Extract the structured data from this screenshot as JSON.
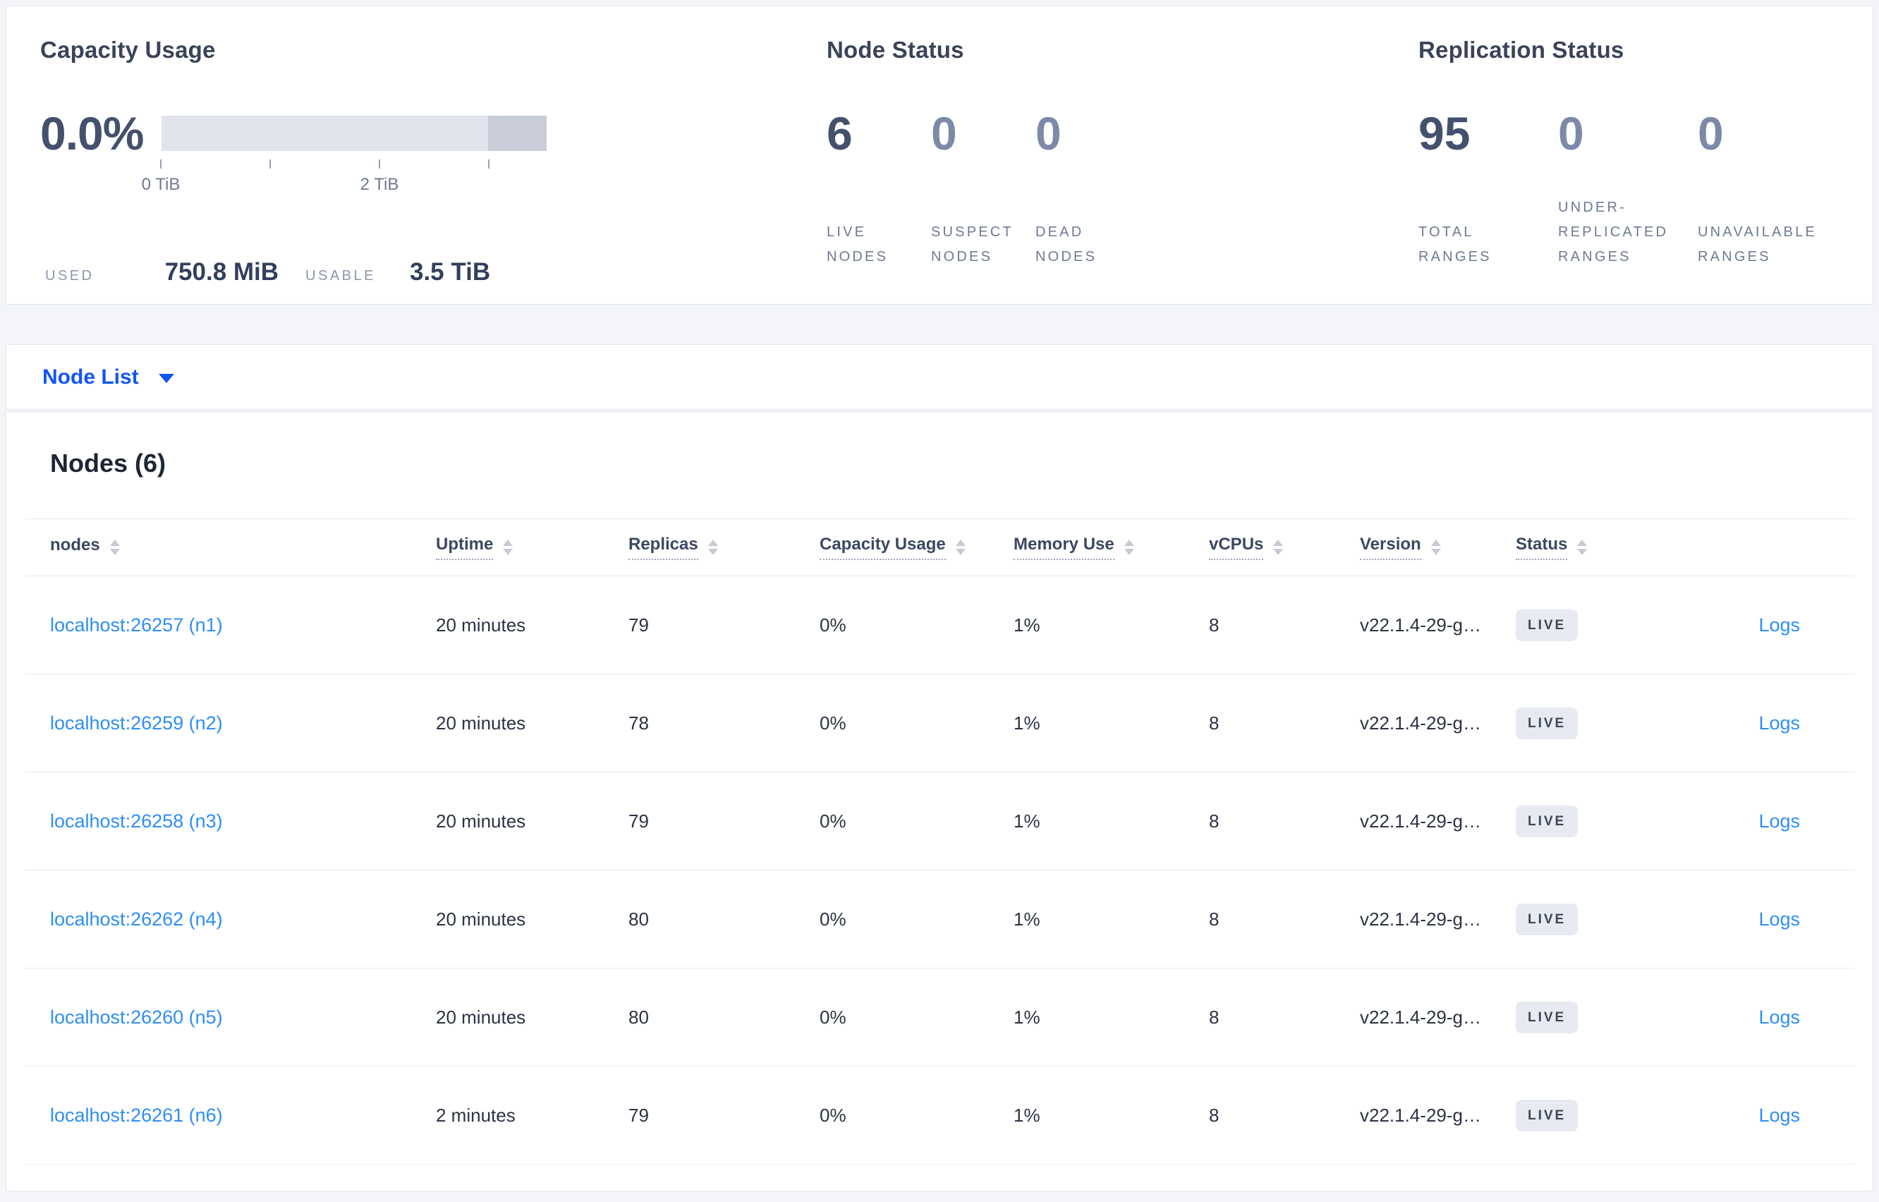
{
  "colors": {
    "primary_blue": "#1355f2",
    "link_blue": "#2f8ef3",
    "emphasis_number": "#44516d",
    "muted_number": "#7c89a8",
    "gauge_light": "#e2e4ed",
    "gauge_dark": "#c8cdd9",
    "live_badge_bg": "#e7eaf1"
  },
  "summary": {
    "capacity": {
      "title": "Capacity Usage",
      "percent": "0.0%",
      "tick_labels": [
        "0 TiB",
        "",
        "2 TiB",
        ""
      ],
      "used_label": "USED",
      "used_value": "750.8 MiB",
      "usable_label": "USABLE",
      "usable_value": "3.5 TiB"
    },
    "node_status": {
      "title": "Node Status",
      "stats": [
        {
          "value": "6",
          "label": "LIVE NODES",
          "emphasis": true
        },
        {
          "value": "0",
          "label": "SUSPECT NODES",
          "emphasis": false
        },
        {
          "value": "0",
          "label": "DEAD NODES",
          "emphasis": false
        }
      ]
    },
    "replication": {
      "title": "Replication Status",
      "stats": [
        {
          "value": "95",
          "label": "TOTAL RANGES",
          "emphasis": true
        },
        {
          "value": "0",
          "label": "UNDER-REPLICATED RANGES",
          "emphasis": false
        },
        {
          "value": "0",
          "label": "UNAVAILABLE RANGES",
          "emphasis": false
        }
      ]
    }
  },
  "node_list": {
    "label": "Node List"
  },
  "nodes_section": {
    "title": "Nodes (6)",
    "columns": [
      {
        "label": "nodes",
        "dotted": false
      },
      {
        "label": "Uptime",
        "dotted": true
      },
      {
        "label": "Replicas",
        "dotted": true
      },
      {
        "label": "Capacity Usage",
        "dotted": true
      },
      {
        "label": "Memory Use",
        "dotted": true
      },
      {
        "label": "vCPUs",
        "dotted": true
      },
      {
        "label": "Version",
        "dotted": true
      },
      {
        "label": "Status",
        "dotted": true
      }
    ],
    "logs_label": "Logs",
    "rows": [
      {
        "node": "localhost:26257 (n1)",
        "uptime": "20 minutes",
        "replicas": "79",
        "capacity_usage": "0%",
        "memory_use": "1%",
        "vcpus": "8",
        "version": "v22.1.4-29-g…",
        "status": "LIVE"
      },
      {
        "node": "localhost:26259 (n2)",
        "uptime": "20 minutes",
        "replicas": "78",
        "capacity_usage": "0%",
        "memory_use": "1%",
        "vcpus": "8",
        "version": "v22.1.4-29-g…",
        "status": "LIVE"
      },
      {
        "node": "localhost:26258 (n3)",
        "uptime": "20 minutes",
        "replicas": "79",
        "capacity_usage": "0%",
        "memory_use": "1%",
        "vcpus": "8",
        "version": "v22.1.4-29-g…",
        "status": "LIVE"
      },
      {
        "node": "localhost:26262 (n4)",
        "uptime": "20 minutes",
        "replicas": "80",
        "capacity_usage": "0%",
        "memory_use": "1%",
        "vcpus": "8",
        "version": "v22.1.4-29-g…",
        "status": "LIVE"
      },
      {
        "node": "localhost:26260 (n5)",
        "uptime": "20 minutes",
        "replicas": "80",
        "capacity_usage": "0%",
        "memory_use": "1%",
        "vcpus": "8",
        "version": "v22.1.4-29-g…",
        "status": "LIVE"
      },
      {
        "node": "localhost:26261 (n6)",
        "uptime": "2 minutes",
        "replicas": "79",
        "capacity_usage": "0%",
        "memory_use": "1%",
        "vcpus": "8",
        "version": "v22.1.4-29-g…",
        "status": "LIVE"
      }
    ]
  }
}
